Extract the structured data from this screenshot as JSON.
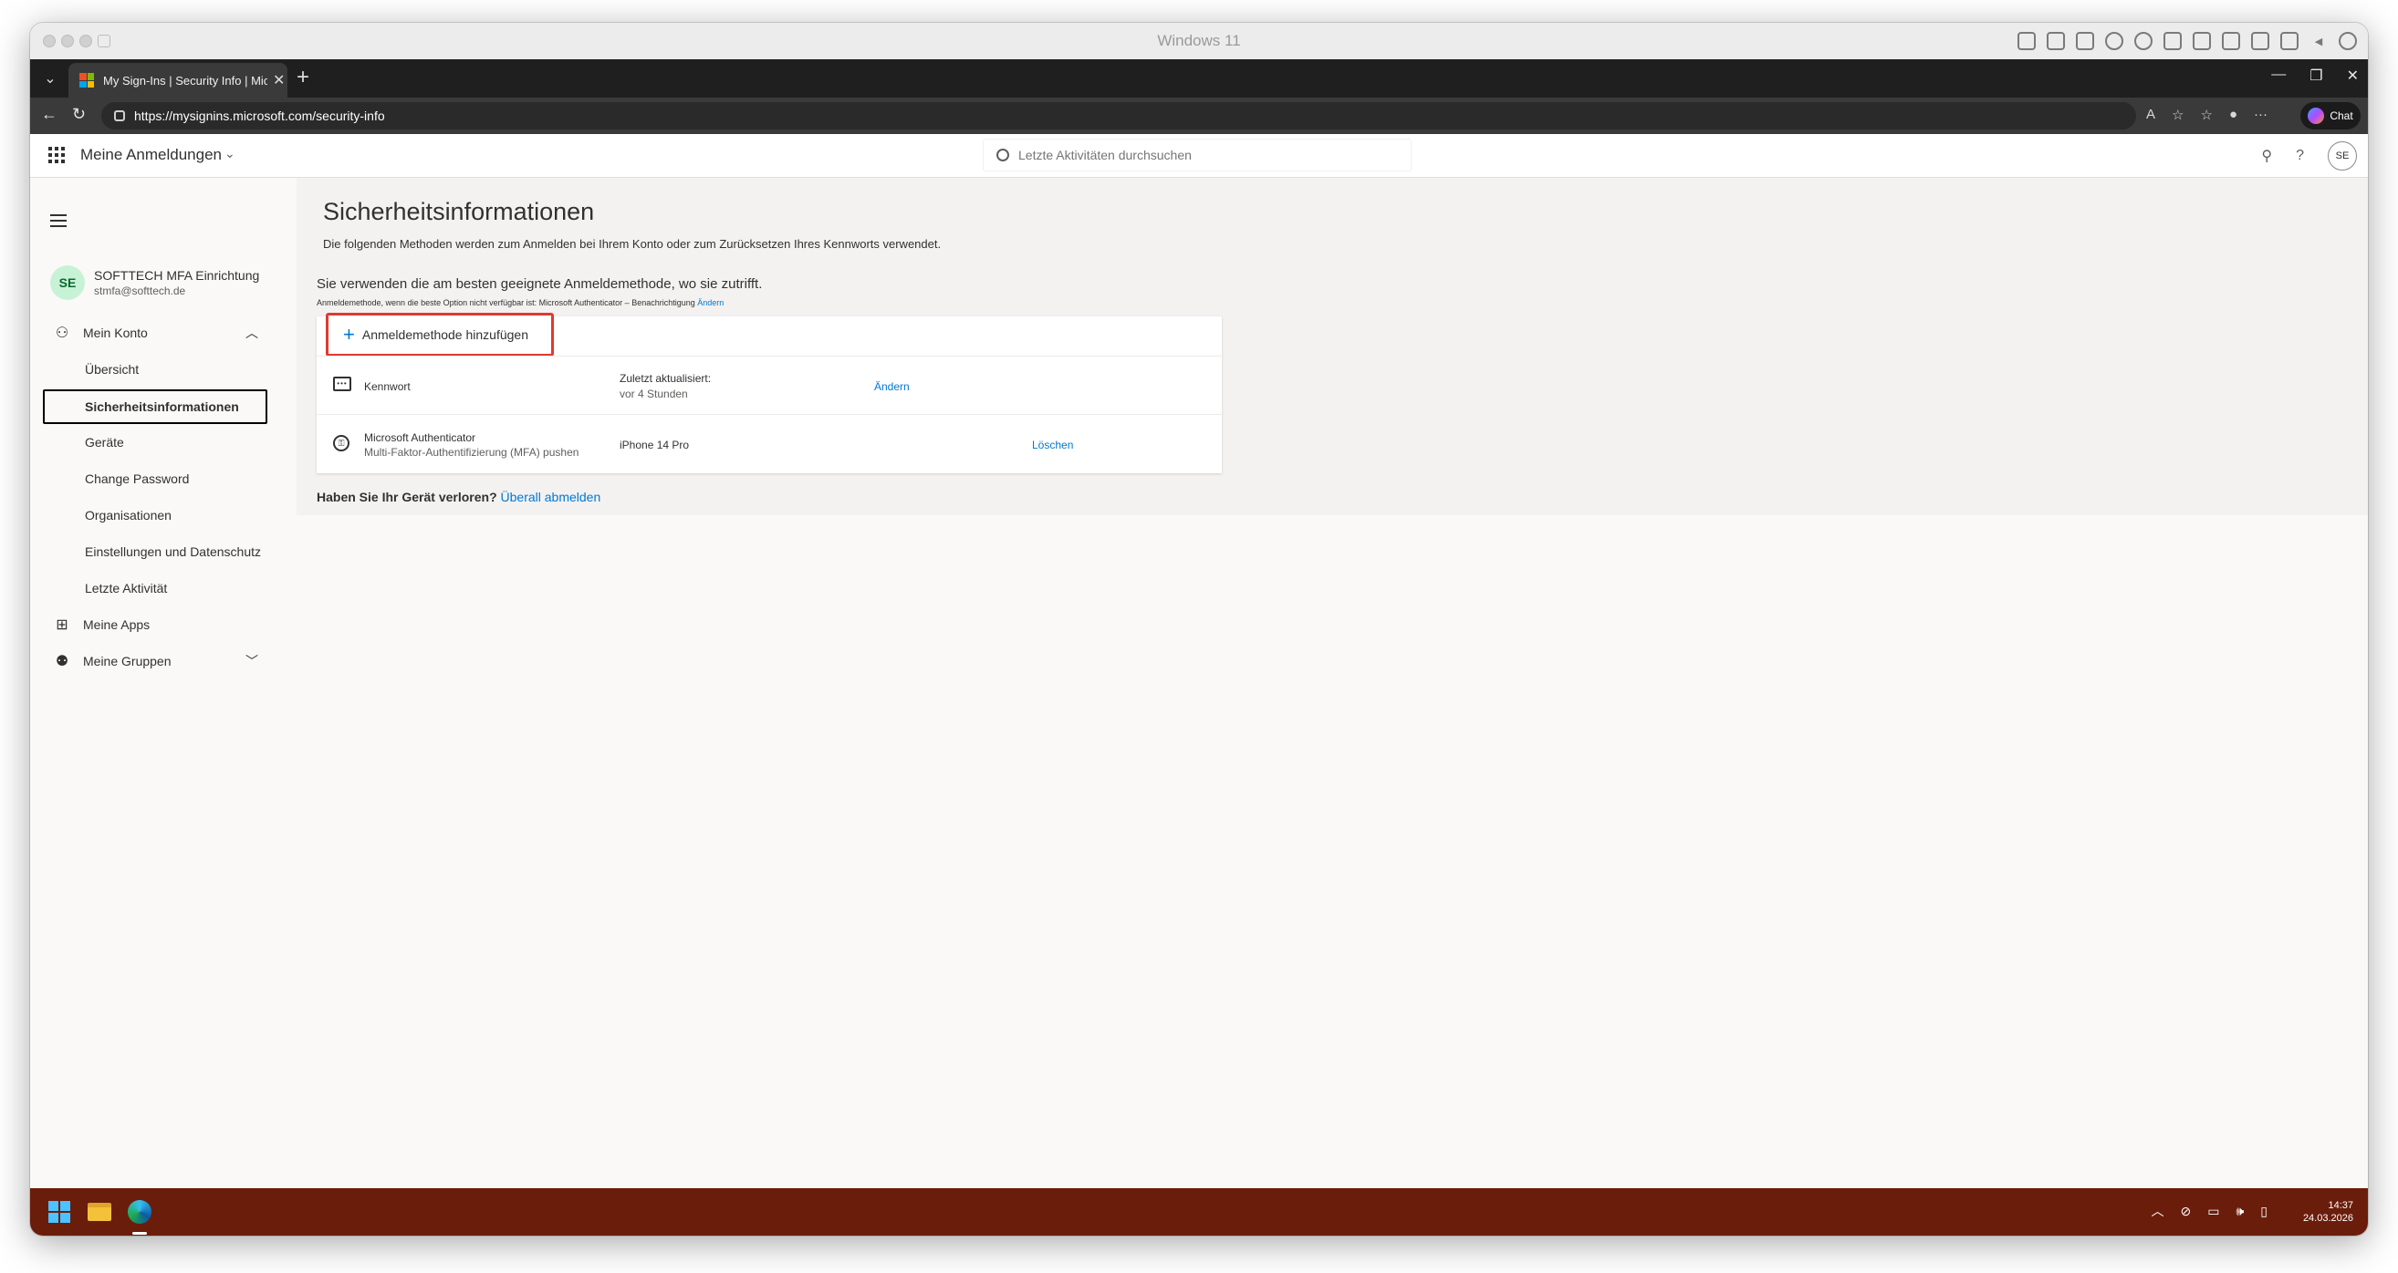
{
  "vm": {
    "title": "Windows 11"
  },
  "browser": {
    "tab_title": "My Sign-Ins | Security Info | Micro",
    "url": "https://mysignins.microsoft.com/security-info",
    "chat_label": "Chat",
    "close_glyph": "✕",
    "new_tab_glyph": "+"
  },
  "header": {
    "app_title": "Meine Anmeldungen",
    "search_placeholder": "Letzte Aktivitäten durchsuchen",
    "help_glyph": "?",
    "avatar_initials": "SE"
  },
  "user": {
    "initials": "SE",
    "name": "SOFTTECH MFA Einrichtung",
    "email": "stmfa@softtech.de"
  },
  "sidebar": {
    "account_label": "Mein Konto",
    "sub_items": [
      "Übersicht",
      "Sicherheitsinformationen",
      "Geräte",
      "Change Password",
      "Organisationen",
      "Einstellungen und Datenschutz",
      "Letzte Aktivität"
    ],
    "apps_label": "Meine Apps",
    "groups_label": "Meine Gruppen",
    "active_index": 1
  },
  "main": {
    "title": "Sicherheitsinformationen",
    "description": "Die folgenden Methoden werden zum Anmelden bei Ihrem Konto oder zum Zurücksetzen Ihres Kennworts verwendet.",
    "default_method_text": "Sie verwenden die am besten geeignete Anmeldemethode, wo sie zutrifft.",
    "default_method_sub": "Anmeldemethode, wenn die beste Option nicht verfügbar ist: Microsoft Authenticator – Benachrichtigung",
    "default_method_link": "Ändern",
    "add_method_label": "Anmeldemethode hinzufügen",
    "methods": [
      {
        "name": "Kennwort",
        "detail_label": "Zuletzt aktualisiert:",
        "detail_value": "vor 4 Stunden",
        "action": "Ändern"
      },
      {
        "name": "Microsoft Authenticator",
        "sub": "Multi-Faktor-Authentifizierung (MFA) pushen",
        "detail_label": "iPhone 14 Pro",
        "action": "Löschen"
      }
    ],
    "lost_device_text": "Haben Sie Ihr Gerät verloren?",
    "lost_device_link": "Überall abmelden"
  },
  "taskbar": {
    "time": "14:37",
    "date": "24.03.2026"
  },
  "colors": {
    "accent": "#0078d4",
    "highlight_box": "#e03a2f",
    "taskbar": "#6b1d0b"
  }
}
